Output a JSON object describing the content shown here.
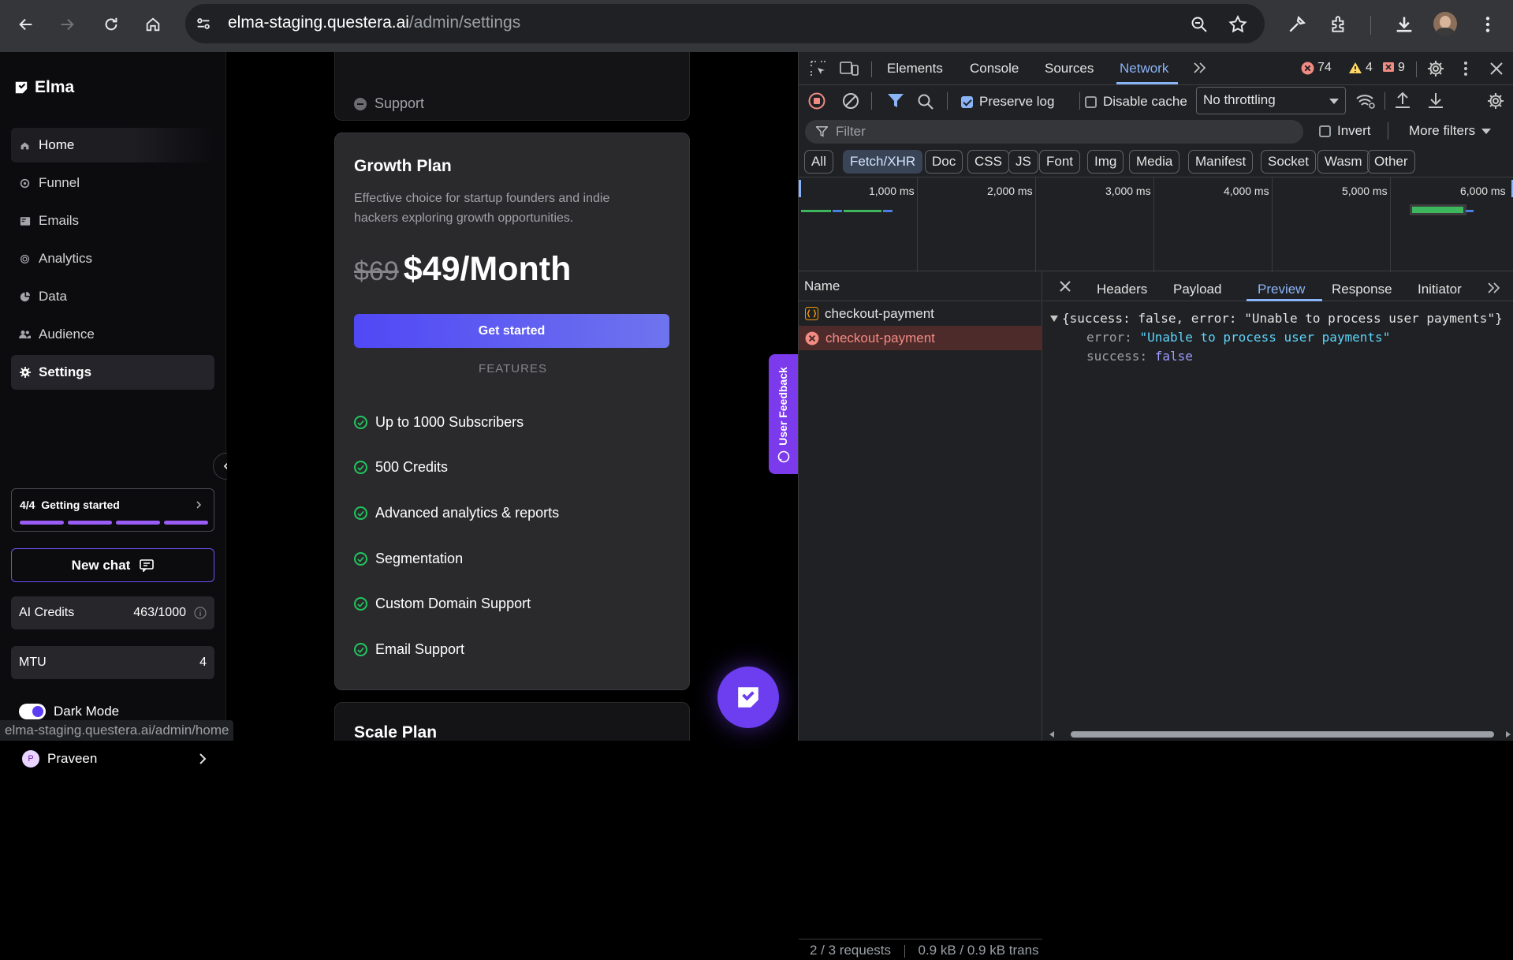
{
  "browser": {
    "url_domain": "elma-staging.questera.ai",
    "url_path": "/admin/settings",
    "status_url": "elma-staging.questera.ai/admin/home"
  },
  "sidebar": {
    "brand": "Elma",
    "items": [
      {
        "label": "Home",
        "icon": "home-icon"
      },
      {
        "label": "Funnel",
        "icon": "funnel-icon"
      },
      {
        "label": "Emails",
        "icon": "mail-icon"
      },
      {
        "label": "Analytics",
        "icon": "analytics-icon"
      },
      {
        "label": "Data",
        "icon": "pie-icon"
      },
      {
        "label": "Audience",
        "icon": "people-icon"
      },
      {
        "label": "Settings",
        "icon": "gear-icon"
      }
    ],
    "getting_started": {
      "count": "4/4",
      "label": "Getting started",
      "progress": 1.0
    },
    "new_chat": "New chat",
    "ai_credits": {
      "label": "AI Credits",
      "value": "463/1000"
    },
    "mtu": {
      "label": "MTU",
      "value": "4"
    },
    "dark_mode": {
      "label": "Dark Mode",
      "enabled": true
    },
    "user": {
      "name": "Praveen",
      "initial": "P"
    }
  },
  "main": {
    "prev_card_item": "Support",
    "growth": {
      "title": "Growth Plan",
      "description": "Effective choice for startup founders and indie hackers exploring growth opportunities.",
      "old_price": "$69",
      "new_price": "$49/Month",
      "cta": "Get started",
      "features_heading": "FEATURES",
      "features": [
        "Up to 1000 Subscribers",
        "500 Credits",
        "Advanced analytics & reports",
        "Segmentation",
        "Custom Domain Support",
        "Email Support"
      ]
    },
    "next_card_title": "Scale Plan",
    "feedback_tab": "User Feedback"
  },
  "devtools": {
    "tabs": [
      "Elements",
      "Console",
      "Sources",
      "Network"
    ],
    "active_tab": "Network",
    "counts": {
      "errors": "74",
      "warnings": "4",
      "issues": "9"
    },
    "preserve_log": "Preserve log",
    "disable_cache": "Disable cache",
    "throttling": "No throttling",
    "filter_placeholder": "Filter",
    "invert": "Invert",
    "more_filters": "More filters",
    "type_filters": [
      "All",
      "Fetch/XHR",
      "Doc",
      "CSS",
      "JS",
      "Font",
      "Img",
      "Media",
      "Manifest",
      "Socket",
      "Wasm",
      "Other"
    ],
    "active_filter": "Fetch/XHR",
    "timeline_ticks": [
      "1,000 ms",
      "2,000 ms",
      "3,000 ms",
      "4,000 ms",
      "5,000 ms",
      "6,000 ms"
    ],
    "name_header": "Name",
    "requests": [
      {
        "name": "checkout-payment",
        "status": "pending"
      },
      {
        "name": "checkout-payment",
        "status": "error"
      }
    ],
    "detail_tabs": [
      "Headers",
      "Payload",
      "Preview",
      "Response",
      "Initiator"
    ],
    "active_detail_tab": "Preview",
    "preview": {
      "summary": "{success: false, error: \"Unable to process user payments\"}",
      "error_key": "error",
      "error_value": "\"Unable to process user payments\"",
      "success_key": "success",
      "success_value": "false"
    },
    "footer_requests": "2 / 3 requests",
    "footer_transferred": "0.9 kB / 0.9 kB trans"
  }
}
